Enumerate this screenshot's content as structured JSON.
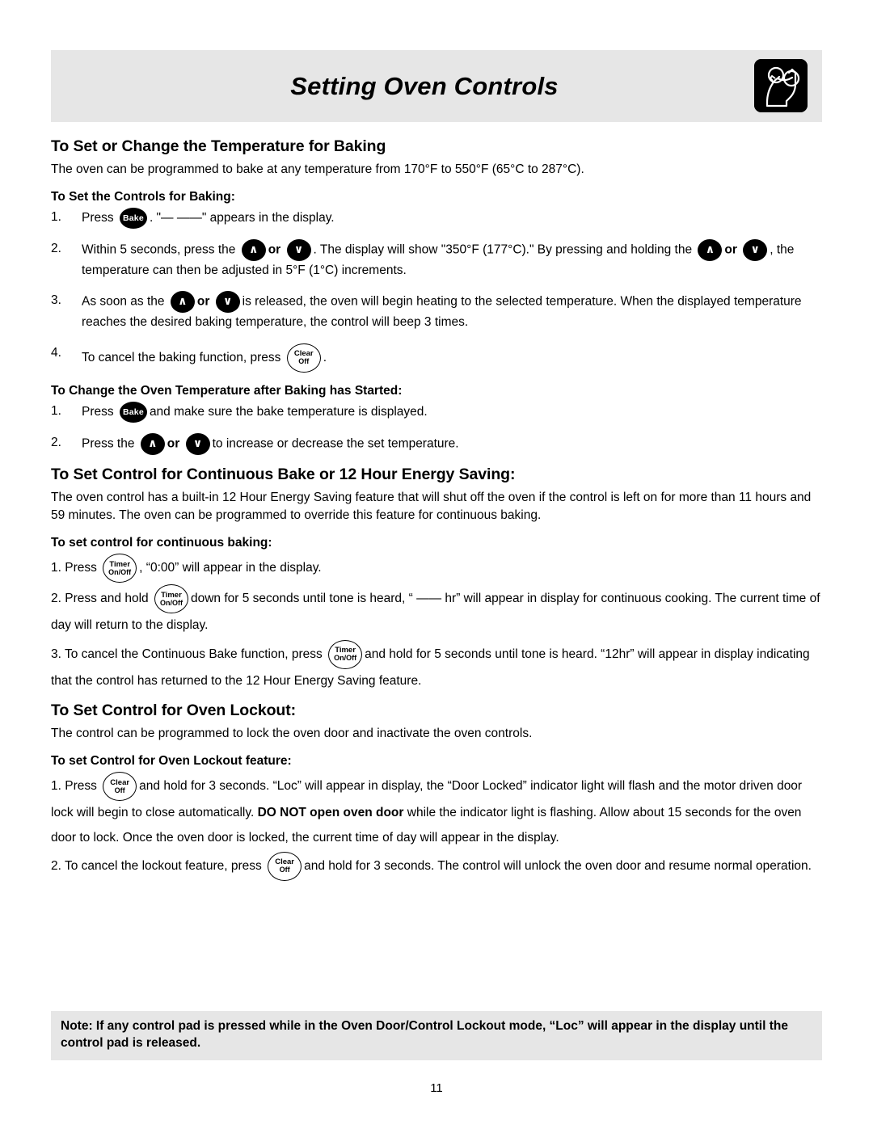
{
  "header": {
    "title": "Setting Oven Controls",
    "icon_name": "hand-pressing-controls-icon"
  },
  "buttons": {
    "bake": {
      "label": "Bake",
      "style": "solid-oval"
    },
    "up": {
      "label": "∧",
      "style": "solid-circle"
    },
    "down": {
      "label": "∨",
      "style": "solid-circle"
    },
    "clear_off": {
      "line1": "Clear",
      "line2": "Off",
      "style": "outline-oval"
    },
    "timer_on_off": {
      "line1": "Timer",
      "line2": "On/Off",
      "style": "outline-oval"
    }
  },
  "sections": {
    "baking": {
      "heading": "To Set or Change the Temperature for Baking",
      "intro": "The oven can be programmed to bake at any temperature from 170°F to 550°F (65°C to 287°C).",
      "sub_heading": "To Set the Controls for Baking:",
      "step1_num": "1.",
      "step1_a": "Press",
      "step1_b": ". \"— ——\" appears in the display.",
      "step2_num": "2.",
      "step2_a": "Within 5 seconds, press the",
      "step2_or1": "or",
      "step2_b": ". The display will show \"350°F (177°C).\" By pressing and holding the",
      "step2_or2": "or",
      "step2_c": ", the temperature can then be adjusted in 5°F (1°C) increments.",
      "step3_num": "3.",
      "step3_a": "As soon as the",
      "step3_or": "or",
      "step3_b": "is released, the oven will begin heating to the selected temperature. When the displayed temperature reaches the desired baking temperature, the control will beep 3 times.",
      "step4_num": "4.",
      "step4_a": "To cancel the baking function, press",
      "step4_b": "."
    },
    "change_temp": {
      "sub_heading": "To Change the Oven Temperature after Baking has Started:",
      "step1_num": "1.",
      "step1_a": "Press",
      "step1_b": "and make sure the bake temperature is displayed.",
      "step2_num": "2.",
      "step2_a": "Press the",
      "step2_or": "or",
      "step2_b": "to increase or decrease the set temperature."
    },
    "continuous_bake": {
      "heading": "To Set Control for Continuous Bake or 12 Hour Energy Saving:",
      "intro": "The oven control has a built-in 12 Hour Energy Saving feature that will shut off the oven if the control is left on for more than 11 hours and 59 minutes. The oven can be programmed to override this feature for continuous baking.",
      "sub_heading": "To set control for continuous baking:",
      "step1_a": "1. Press",
      "step1_b": ", “0:00” will appear in the display.",
      "step2_a": "2. Press and hold",
      "step2_b": "down for 5 seconds until tone is heard, “ ——  hr” will appear in display for continuous cooking. The current time of day will return to the display.",
      "step3_a": "3. To cancel the Continuous Bake function, press",
      "step3_b": "and hold for 5 seconds until tone is heard. “12hr” will appear in display indicating that the control has returned to the 12 Hour Energy Saving feature."
    },
    "oven_lockout": {
      "heading": "To Set Control for Oven Lockout:",
      "intro": "The control can be programmed to lock the oven door and inactivate the oven controls.",
      "sub_heading": "To set Control for Oven Lockout feature:",
      "step1_a": "1. Press",
      "step1_b": "and hold for 3 seconds. “Loc” will appear in display, the “Door Locked” indicator light will flash and the motor driven door lock will begin to close automatically.",
      "step1_bold": "DO NOT open oven door",
      "step1_c": "while the indicator light is flashing. Allow about 15 seconds for the oven door to lock. Once the oven door is locked, the current time of day will appear in the display.",
      "step2_a": "2. To cancel the lockout feature, press",
      "step2_b": "and hold for 3 seconds. The control will unlock the oven door and resume normal operation."
    }
  },
  "note": {
    "text": "Note: If any control pad is pressed while in the Oven Door/Control Lockout mode, “Loc” will appear in the display until the control pad is released."
  },
  "footer": {
    "page_number": "11"
  },
  "colors": {
    "band_background": "#e6e6e6",
    "text": "#000000",
    "page_background": "#ffffff"
  }
}
